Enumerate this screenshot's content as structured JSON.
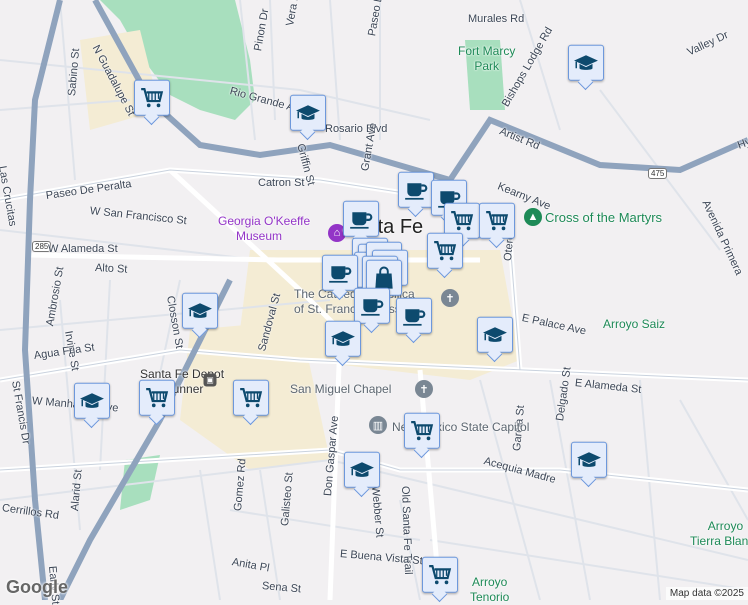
{
  "map": {
    "city_label": "Santa Fe",
    "attribution": "Map data ©2025",
    "logo": "Google",
    "colors": {
      "background": "#f2f0f2",
      "park": "#a8dfbe",
      "downtown": "#f4ecd4",
      "highway": "#8fa3bd",
      "road": "#ffffff",
      "pin_bg": "#e4ecfb",
      "pin_border": "#6d98dc",
      "icon": "#0d4a6e"
    },
    "route_shields": [
      "285",
      "475"
    ],
    "places": [
      {
        "name": "Georgia O'Keeffe Museum",
        "line1": "Georgia O'Keeffe",
        "line2": "Museum",
        "kind": "museum"
      },
      {
        "name": "Fort Marcy Park",
        "line1": "Fort Marcy",
        "line2": "Park",
        "kind": "park"
      },
      {
        "name": "Cross of the Martyrs",
        "line1": "Cross of the Martyrs",
        "line2": "",
        "kind": "park"
      },
      {
        "name": "Arroyo Saiz",
        "line1": "Arroyo Saiz",
        "line2": "",
        "kind": "park"
      },
      {
        "name": "The Cathedral Basilica of St. Francis",
        "line1": "The Cathedral Basilica",
        "line2": "of St. Francis of Assisi",
        "kind": "church"
      },
      {
        "name": "Santa Fe Depot Rail Runner",
        "line1": "Santa Fe Depot",
        "line2": "Rail Runner",
        "kind": "transit"
      },
      {
        "name": "San Miguel Chapel",
        "line1": "San Miguel Chapel",
        "line2": "",
        "kind": "church"
      },
      {
        "name": "New Mexico State Capitol",
        "line1": "New Mexico State Capitol",
        "line2": "",
        "kind": "government"
      },
      {
        "name": "Arroyo Tierra Blanca",
        "line1": "Arroyo",
        "line2": "Tierra Blanca",
        "kind": "park"
      },
      {
        "name": "Arroyo Tenorio",
        "line1": "Arroyo",
        "line2": "Tenorio",
        "kind": "park"
      }
    ],
    "streets": [
      "N Guadalupe St",
      "Rio Grande Ave",
      "Pinon Dr",
      "Vera Dr",
      "Rosario Blvd",
      "Griffin St",
      "Paseo De La Cuma",
      "Murales Rd",
      "Bishops Lodge Rd",
      "Valley Dr",
      "Artist Rd",
      "Hyde Park Rd",
      "Kearny Ave",
      "Avenida Primera",
      "Paseo De Peralta",
      "Catron St",
      "Grant Ave",
      "W San Francisco St",
      "W Alameda St",
      "Alto St",
      "Sabino St",
      "Closson St",
      "Ambrosio St",
      "Irvine St",
      "Agua Fria St",
      "W Manhattan Ave",
      "St Francis Dr",
      "Sandoval St",
      "Otero St",
      "E Palace Ave",
      "E Alameda St",
      "Delgado St",
      "Garcia St",
      "Acequia Madre",
      "Old Santa Fe Trail",
      "Don Gaspar Ave",
      "Webber St",
      "Galisteo St",
      "Gomez Rd",
      "Anita Pl",
      "Sena St",
      "E Buena Vista St",
      "Alarid St",
      "Early St",
      "Las Crucitas",
      "Cerrillos Rd"
    ],
    "markers": [
      {
        "type": "cart"
      },
      {
        "type": "school"
      },
      {
        "type": "school"
      },
      {
        "type": "coffee"
      },
      {
        "type": "coffee"
      },
      {
        "type": "cart"
      },
      {
        "type": "cart"
      },
      {
        "type": "coffee"
      },
      {
        "type": "cart"
      },
      {
        "type": "shopping-bag"
      },
      {
        "type": "coffee"
      },
      {
        "type": "coffee"
      },
      {
        "type": "coffee"
      },
      {
        "type": "school"
      },
      {
        "type": "school"
      },
      {
        "type": "school"
      },
      {
        "type": "school"
      },
      {
        "type": "cart"
      },
      {
        "type": "cart"
      },
      {
        "type": "cart"
      },
      {
        "type": "school"
      },
      {
        "type": "school"
      },
      {
        "type": "cart"
      }
    ]
  }
}
